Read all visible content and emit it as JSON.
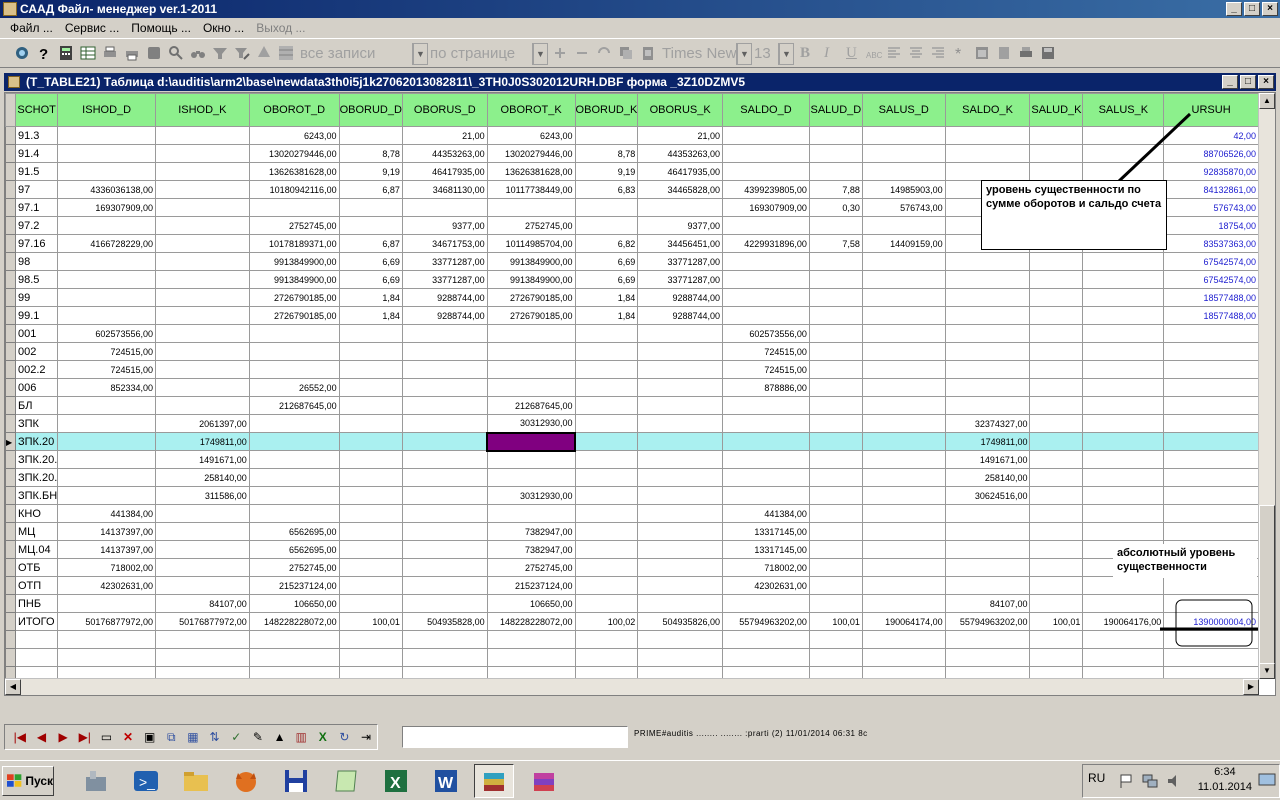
{
  "app": {
    "title": "САAД Файл- менеджер ver.1-2011"
  },
  "menu": [
    {
      "label": "Файл ...",
      "disabled": false
    },
    {
      "label": "Сервис ...",
      "disabled": false
    },
    {
      "label": "Помощь ...",
      "disabled": false
    },
    {
      "label": "Окно ...",
      "disabled": false
    },
    {
      "label": "Выход ...",
      "disabled": true
    }
  ],
  "toolbar": {
    "records_select": "все записи",
    "page_select": "по странице",
    "font_select": "Times New",
    "size_select": "13",
    "bold": "B",
    "italic": "I",
    "underline": "U",
    "abc": "ABC"
  },
  "child": {
    "title": "(T_TABLE21)  Таблица d:\\auditis\\arm2\\base\\newdata3th0i5j1k27062013082811\\_3TH0J0S302012URH.DBF форма _3Z10DZMV5"
  },
  "table": {
    "columns": [
      "SCHOT",
      "ISHOD_D",
      "ISHOD_K",
      "OBOROT_D",
      "OBORUD_D",
      "OBORUS_D",
      "OBOROT_K",
      "OBORUD_K",
      "OBORUS_K",
      "SALDO_D",
      "SALUD_D",
      "SALUS_D",
      "SALDO_K",
      "SALUD_K",
      "SALUS_K",
      "URSUH"
    ],
    "rows": [
      [
        "91.3",
        "",
        "",
        "6243,00",
        "",
        "21,00",
        "6243,00",
        "",
        "21,00",
        "",
        "",
        "",
        "",
        "",
        "",
        "42,00"
      ],
      [
        "91.4",
        "",
        "",
        "13020279446,00",
        "8,78",
        "44353263,00",
        "13020279446,00",
        "8,78",
        "44353263,00",
        "",
        "",
        "",
        "",
        "",
        "",
        "88706526,00"
      ],
      [
        "91.5",
        "",
        "",
        "13626381628,00",
        "9,19",
        "46417935,00",
        "13626381628,00",
        "9,19",
        "46417935,00",
        "",
        "",
        "",
        "",
        "",
        "",
        "92835870,00"
      ],
      [
        "97",
        "4336036138,00",
        "",
        "10180942116,00",
        "6,87",
        "34681130,00",
        "10117738449,00",
        "6,83",
        "34465828,00",
        "4399239805,00",
        "7,88",
        "14985903,00",
        "",
        "",
        "",
        "84132861,00"
      ],
      [
        "97.1",
        "169307909,00",
        "",
        "",
        "",
        "",
        "",
        "",
        "",
        "169307909,00",
        "0,30",
        "576743,00",
        "",
        "",
        "",
        "576743,00"
      ],
      [
        "97.2",
        "",
        "",
        "2752745,00",
        "",
        "9377,00",
        "2752745,00",
        "",
        "9377,00",
        "",
        "",
        "",
        "",
        "",
        "",
        "18754,00"
      ],
      [
        "97.16",
        "4166728229,00",
        "",
        "10178189371,00",
        "6,87",
        "34671753,00",
        "10114985704,00",
        "6,82",
        "34456451,00",
        "4229931896,00",
        "7,58",
        "14409159,00",
        "",
        "",
        "",
        "83537363,00"
      ],
      [
        "98",
        "",
        "",
        "9913849900,00",
        "6,69",
        "33771287,00",
        "9913849900,00",
        "6,69",
        "33771287,00",
        "",
        "",
        "",
        "",
        "",
        "",
        "67542574,00"
      ],
      [
        "98.5",
        "",
        "",
        "9913849900,00",
        "6,69",
        "33771287,00",
        "9913849900,00",
        "6,69",
        "33771287,00",
        "",
        "",
        "",
        "",
        "",
        "",
        "67542574,00"
      ],
      [
        "99",
        "",
        "",
        "2726790185,00",
        "1,84",
        "9288744,00",
        "2726790185,00",
        "1,84",
        "9288744,00",
        "",
        "",
        "",
        "",
        "",
        "",
        "18577488,00"
      ],
      [
        "99.1",
        "",
        "",
        "2726790185,00",
        "1,84",
        "9288744,00",
        "2726790185,00",
        "1,84",
        "9288744,00",
        "",
        "",
        "",
        "",
        "",
        "",
        "18577488,00"
      ],
      [
        "001",
        "602573556,00",
        "",
        "",
        "",
        "",
        "",
        "",
        "",
        "602573556,00",
        "",
        "",
        "",
        "",
        "",
        ""
      ],
      [
        "002",
        "724515,00",
        "",
        "",
        "",
        "",
        "",
        "",
        "",
        "724515,00",
        "",
        "",
        "",
        "",
        "",
        ""
      ],
      [
        "002.2",
        "724515,00",
        "",
        "",
        "",
        "",
        "",
        "",
        "",
        "724515,00",
        "",
        "",
        "",
        "",
        "",
        ""
      ],
      [
        "006",
        "852334,00",
        "",
        "26552,00",
        "",
        "",
        "",
        "",
        "",
        "878886,00",
        "",
        "",
        "",
        "",
        "",
        ""
      ],
      [
        "БЛ",
        "",
        "",
        "212687645,00",
        "",
        "",
        "212687645,00",
        "",
        "",
        "",
        "",
        "",
        "",
        "",
        "",
        ""
      ],
      [
        "ЗПК",
        "",
        "2061397,00",
        "",
        "",
        "",
        "30312930,00",
        "",
        "",
        "",
        "",
        "",
        "32374327,00",
        "",
        "",
        ""
      ],
      [
        "ЗПК.20",
        "",
        "1749811,00",
        "",
        "",
        "",
        "",
        "",
        "",
        "",
        "",
        "",
        "1749811,00",
        "",
        "",
        ""
      ],
      [
        "ЗПК.20.",
        "",
        "1491671,00",
        "",
        "",
        "",
        "",
        "",
        "",
        "",
        "",
        "",
        "1491671,00",
        "",
        "",
        ""
      ],
      [
        "ЗПК.20.",
        "",
        "258140,00",
        "",
        "",
        "",
        "",
        "",
        "",
        "",
        "",
        "",
        "258140,00",
        "",
        "",
        ""
      ],
      [
        "ЗПК.БН",
        "",
        "311586,00",
        "",
        "",
        "",
        "30312930,00",
        "",
        "",
        "",
        "",
        "",
        "30624516,00",
        "",
        "",
        ""
      ],
      [
        "КНО",
        "441384,00",
        "",
        "",
        "",
        "",
        "",
        "",
        "",
        "441384,00",
        "",
        "",
        "",
        "",
        "",
        ""
      ],
      [
        "МЦ",
        "14137397,00",
        "",
        "6562695,00",
        "",
        "",
        "7382947,00",
        "",
        "",
        "13317145,00",
        "",
        "",
        "",
        "",
        "",
        ""
      ],
      [
        "МЦ.04",
        "14137397,00",
        "",
        "6562695,00",
        "",
        "",
        "7382947,00",
        "",
        "",
        "13317145,00",
        "",
        "",
        "",
        "",
        "",
        ""
      ],
      [
        "ОТБ",
        "718002,00",
        "",
        "2752745,00",
        "",
        "",
        "2752745,00",
        "",
        "",
        "718002,00",
        "",
        "",
        "",
        "",
        "",
        ""
      ],
      [
        "ОТП",
        "42302631,00",
        "",
        "215237124,00",
        "",
        "",
        "215237124,00",
        "",
        "",
        "42302631,00",
        "",
        "",
        "",
        "",
        "",
        ""
      ],
      [
        "ПНБ",
        "",
        "84107,00",
        "106650,00",
        "",
        "",
        "106650,00",
        "",
        "",
        "",
        "",
        "",
        "84107,00",
        "",
        "",
        ""
      ],
      [
        "ИТОГО",
        "50176877972,00",
        "50176877972,00",
        "148228228072,00",
        "100,01",
        "504935828,00",
        "148228228072,00",
        "100,02",
        "504935826,00",
        "55794963202,00",
        "100,01",
        "190064174,00",
        "55794963202,00",
        "100,01",
        "190064176,00",
        "1390000004,00"
      ]
    ],
    "selected_row": 17
  },
  "annotations": {
    "materiality_turnover": "уровень существенности по сумме оборотов и сальдо счета",
    "absolute_materiality": "абсолютный уровень существенности"
  },
  "status": {
    "text": "PRIME#auditis  ........  ........ :prarti (2) 11/01/2014 06:31 8с"
  },
  "taskbar": {
    "start": "Пуск",
    "lang": "RU",
    "time": "6:34",
    "date": "11.01.2014"
  }
}
